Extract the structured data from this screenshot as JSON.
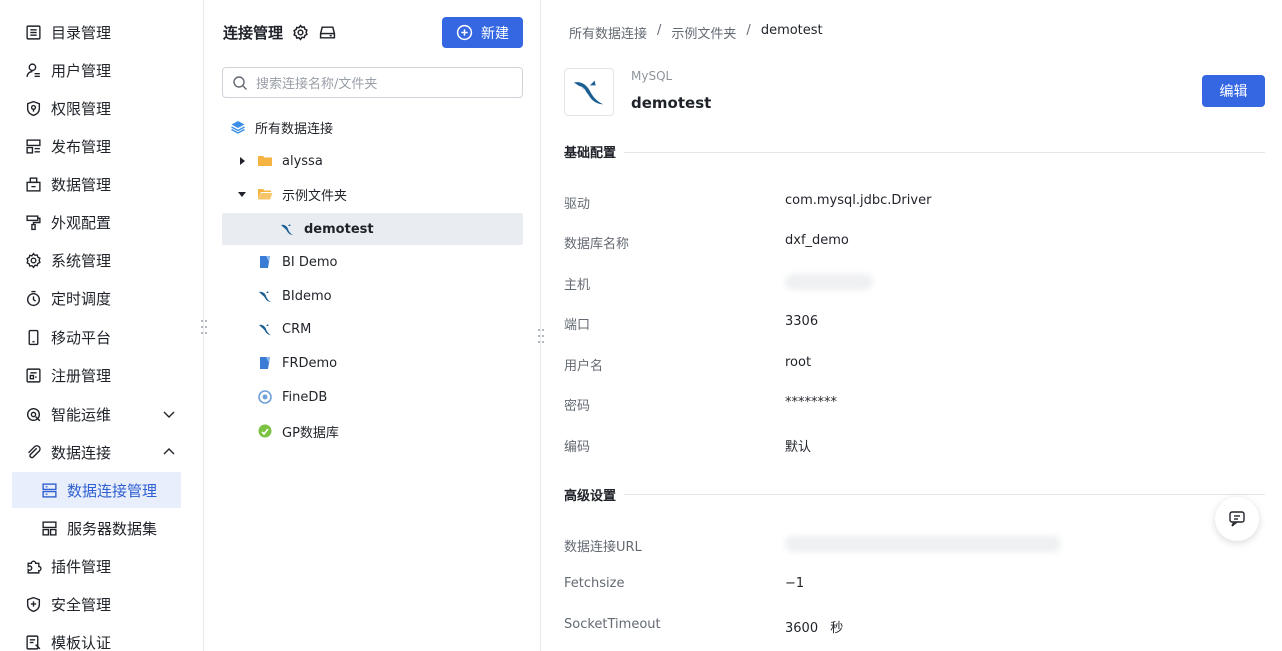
{
  "nav": {
    "items": [
      {
        "label": "目录管理",
        "icon": "catalog-icon"
      },
      {
        "label": "用户管理",
        "icon": "user-icon"
      },
      {
        "label": "权限管理",
        "icon": "shield-check-icon"
      },
      {
        "label": "发布管理",
        "icon": "publish-icon"
      },
      {
        "label": "数据管理",
        "icon": "database-box-icon"
      },
      {
        "label": "外观配置",
        "icon": "paint-roller-icon"
      },
      {
        "label": "系统管理",
        "icon": "gear-icon"
      },
      {
        "label": "定时调度",
        "icon": "stopwatch-icon"
      },
      {
        "label": "移动平台",
        "icon": "mobile-icon"
      },
      {
        "label": "注册管理",
        "icon": "register-icon"
      },
      {
        "label": "智能运维",
        "icon": "smart-ops-icon"
      },
      {
        "label": "数据连接",
        "icon": "paperclip-icon"
      },
      {
        "label": "数据连接管理",
        "icon": "connection-manage-icon"
      },
      {
        "label": "服务器数据集",
        "icon": "server-dataset-icon"
      },
      {
        "label": "插件管理",
        "icon": "puzzle-icon"
      },
      {
        "label": "安全管理",
        "icon": "security-icon"
      },
      {
        "label": "模板认证",
        "icon": "template-cert-icon"
      }
    ]
  },
  "tree_panel": {
    "title": "连接管理",
    "new_button": "新建",
    "search_placeholder": "搜索连接名称/文件夹",
    "root": "所有数据连接",
    "folders": [
      {
        "name": "alyssa",
        "expanded": false
      },
      {
        "name": "示例文件夹",
        "expanded": true
      }
    ],
    "selected_child": "demotest",
    "connections": [
      {
        "name": "BI Demo",
        "icon": "fr-icon"
      },
      {
        "name": "BIdemo",
        "icon": "mysql-icon"
      },
      {
        "name": "CRM",
        "icon": "mysql-icon"
      },
      {
        "name": "FRDemo",
        "icon": "fr-icon"
      },
      {
        "name": "FineDB",
        "icon": "finedb-icon"
      },
      {
        "name": "GP数据库",
        "icon": "greenplum-icon"
      }
    ]
  },
  "detail": {
    "breadcrumb": [
      "所有数据连接",
      "示例文件夹",
      "demotest"
    ],
    "breadcrumb_sep": "/",
    "db_type": "MySQL",
    "db_name": "demotest",
    "edit_button": "编辑",
    "basic_section": "基础配置",
    "basic": [
      {
        "label": "驱动",
        "value": "com.mysql.jdbc.Driver"
      },
      {
        "label": "数据库名称",
        "value": "dxf_demo"
      },
      {
        "label": "主机",
        "value": ""
      },
      {
        "label": "端口",
        "value": "3306"
      },
      {
        "label": "用户名",
        "value": "root"
      },
      {
        "label": "密码",
        "value": "********"
      },
      {
        "label": "编码",
        "value": "默认"
      }
    ],
    "advanced_section": "高级设置",
    "advanced": [
      {
        "label": "数据连接URL",
        "value": ""
      },
      {
        "label": "Fetchsize",
        "value": "−1"
      },
      {
        "label": "SocketTimeout",
        "value": "3600",
        "unit": "秒"
      }
    ]
  },
  "colors": {
    "primary": "#3567e3",
    "active_bg": "#e8eefb",
    "active_text": "#2f5fd0"
  }
}
